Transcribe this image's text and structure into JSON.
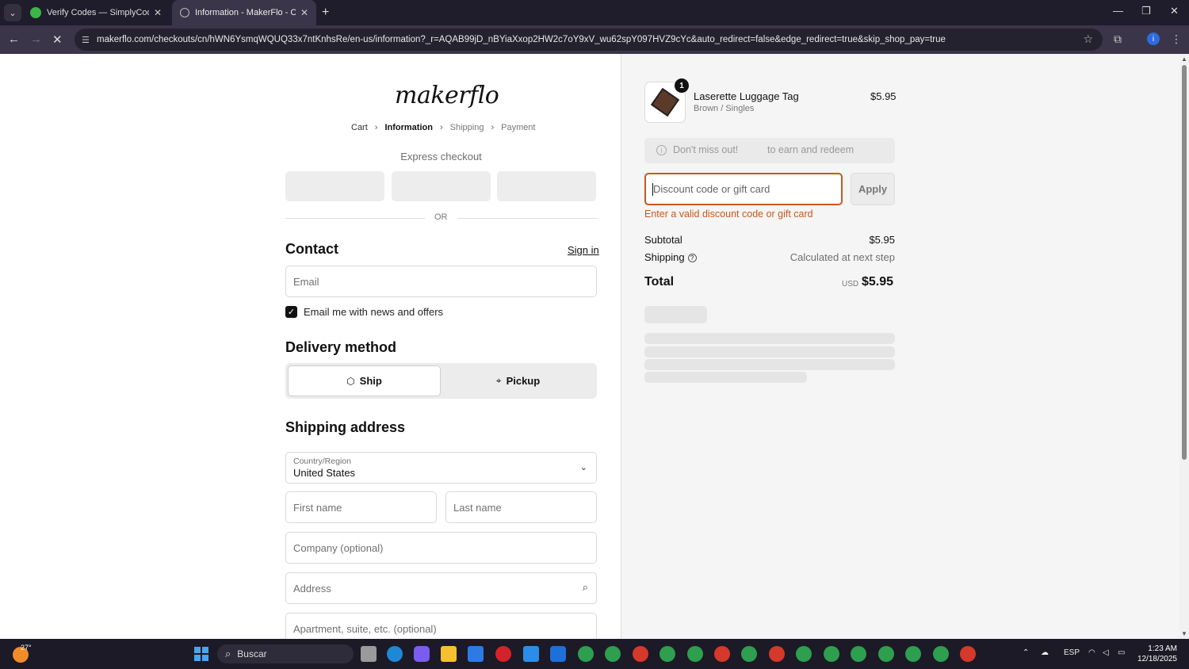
{
  "browser": {
    "tabs": [
      {
        "title": "Verify Codes — SimplyCodes",
        "active": false
      },
      {
        "title": "Information - MakerFlo - Check",
        "active": true
      }
    ],
    "url": "makerflo.com/checkouts/cn/hWN6YsmqWQUQ33x7ntKnhsRe/en-us/information?_r=AQAB99jD_nBYiaXxop2HW2c7oY9xV_wu62spY097HVZ9cYc&auto_redirect=false&edge_redirect=true&skip_shop_pay=true",
    "profile_initial": "i"
  },
  "checkout": {
    "logo": "makerflo",
    "breadcrumb": [
      "Cart",
      "Information",
      "Shipping",
      "Payment"
    ],
    "express_label": "Express checkout",
    "or_label": "OR",
    "contact_title": "Contact",
    "signin_label": "Sign in",
    "email_placeholder": "Email",
    "newsletter_label": "Email me with news and offers",
    "newsletter_checked": true,
    "delivery_title": "Delivery method",
    "delivery_options": [
      {
        "label": "Ship",
        "selected": true,
        "icon": "box-icon"
      },
      {
        "label": "Pickup",
        "selected": false,
        "icon": "location-pin-icon"
      }
    ],
    "shipping_title": "Shipping address",
    "country_label": "Country/Region",
    "country_value": "United States",
    "first_name_placeholder": "First name",
    "last_name_placeholder": "Last name",
    "company_placeholder": "Company (optional)",
    "address_placeholder": "Address",
    "apartment_placeholder": "Apartment, suite, etc. (optional)"
  },
  "summary": {
    "item": {
      "name": "Laserette Luggage Tag",
      "variant": "Brown / Singles",
      "price": "$5.95",
      "quantity": "1"
    },
    "promo_text_1": "Don't miss out!",
    "promo_text_2": "to earn and redeem",
    "discount_placeholder": "Discount code or gift card",
    "apply_label": "Apply",
    "error_text": "Enter a valid discount code or gift card",
    "subtotal_label": "Subtotal",
    "subtotal_value": "$5.95",
    "shipping_label": "Shipping",
    "shipping_value": "Calculated at next step",
    "total_label": "Total",
    "total_currency": "USD",
    "total_value": "$5.95"
  },
  "taskbar": {
    "temperature": "27°",
    "search_label": "Buscar",
    "language": "ESP",
    "time": "1:23 AM",
    "date": "12/18/2025"
  },
  "colors": {
    "accent_error": "#c8581a",
    "chrome_dark": "#1f1c2c"
  }
}
